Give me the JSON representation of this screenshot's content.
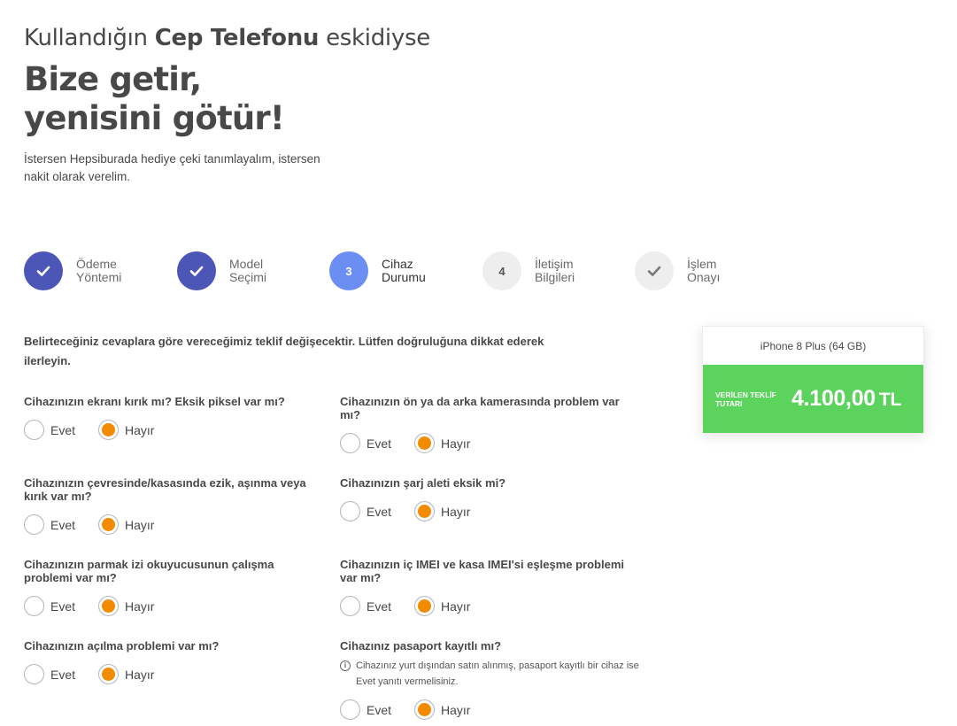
{
  "hero": {
    "line1_prefix": "Kullandığın ",
    "line1_bold": "Cep Telefonu",
    "line1_suffix": " eskidiyse",
    "title_line1": "Bize getir,",
    "title_line2": "yenisini götür!",
    "description": "İstersen Hepsiburada hediye çeki tanımlayalım, istersen nakit olarak verelim."
  },
  "steps": [
    {
      "label": "Ödeme\nYöntemi",
      "status": "done",
      "icon": "check-icon"
    },
    {
      "label": "Model\nSeçimi",
      "status": "done",
      "icon": "check-icon"
    },
    {
      "label": "Cihaz\nDurumu",
      "status": "active",
      "number": "3"
    },
    {
      "label": "İletişim\nBilgileri",
      "status": "pending",
      "number": "4"
    },
    {
      "label": "İşlem\nOnayı",
      "status": "pending",
      "icon": "check-icon"
    }
  ],
  "intro_text": "Belirteceğiniz cevaplara göre vereceğimiz teklif değişecektir. Lütfen doğruluğuna dikkat ederek ilerleyin.",
  "option_labels": {
    "yes": "Evet",
    "no": "Hayır"
  },
  "questions": [
    {
      "text": "Cihazınızın ekranı kırık mı? Eksik piksel var mı?",
      "selected": "Hayır"
    },
    {
      "text": "Cihazınızın ön ya da arka kamerasında problem var mı?",
      "selected": "Hayır"
    },
    {
      "text": "Cihazınızın çevresinde/kasasında ezik, aşınma veya kırık var mı?",
      "selected": "Hayır"
    },
    {
      "text": "Cihazınızın şarj aleti eksik mi?",
      "selected": "Hayır"
    },
    {
      "text": "Cihazınızın parmak izi okuyucusunun çalışma problemi var mı?",
      "selected": "Hayır"
    },
    {
      "text": "Cihazınızın iç IMEI ve kasa IMEI'si eşleşme problemi var mı?",
      "selected": "Hayır"
    },
    {
      "text": "Cihazınızın açılma problemi var mı?",
      "selected": "Hayır"
    },
    {
      "text": "Cihazınız pasaport kayıtlı mı?",
      "selected": "Hayır",
      "note": "Cihazınız yurt dışından satın alınmış, pasaport kayıtlı bir cihaz ise Evet yanıtı vermelisiniz."
    }
  ],
  "offer": {
    "model": "iPhone 8 Plus (64 GB)",
    "caption": "VERİLEN TEKLİF TUTARI",
    "amount": "4.100,00",
    "currency": "TL"
  },
  "colors": {
    "step_done": "#4c56b7",
    "step_active": "#6b8ef2",
    "radio_selected": "#f28b00",
    "offer_green": "#5cd35c"
  }
}
